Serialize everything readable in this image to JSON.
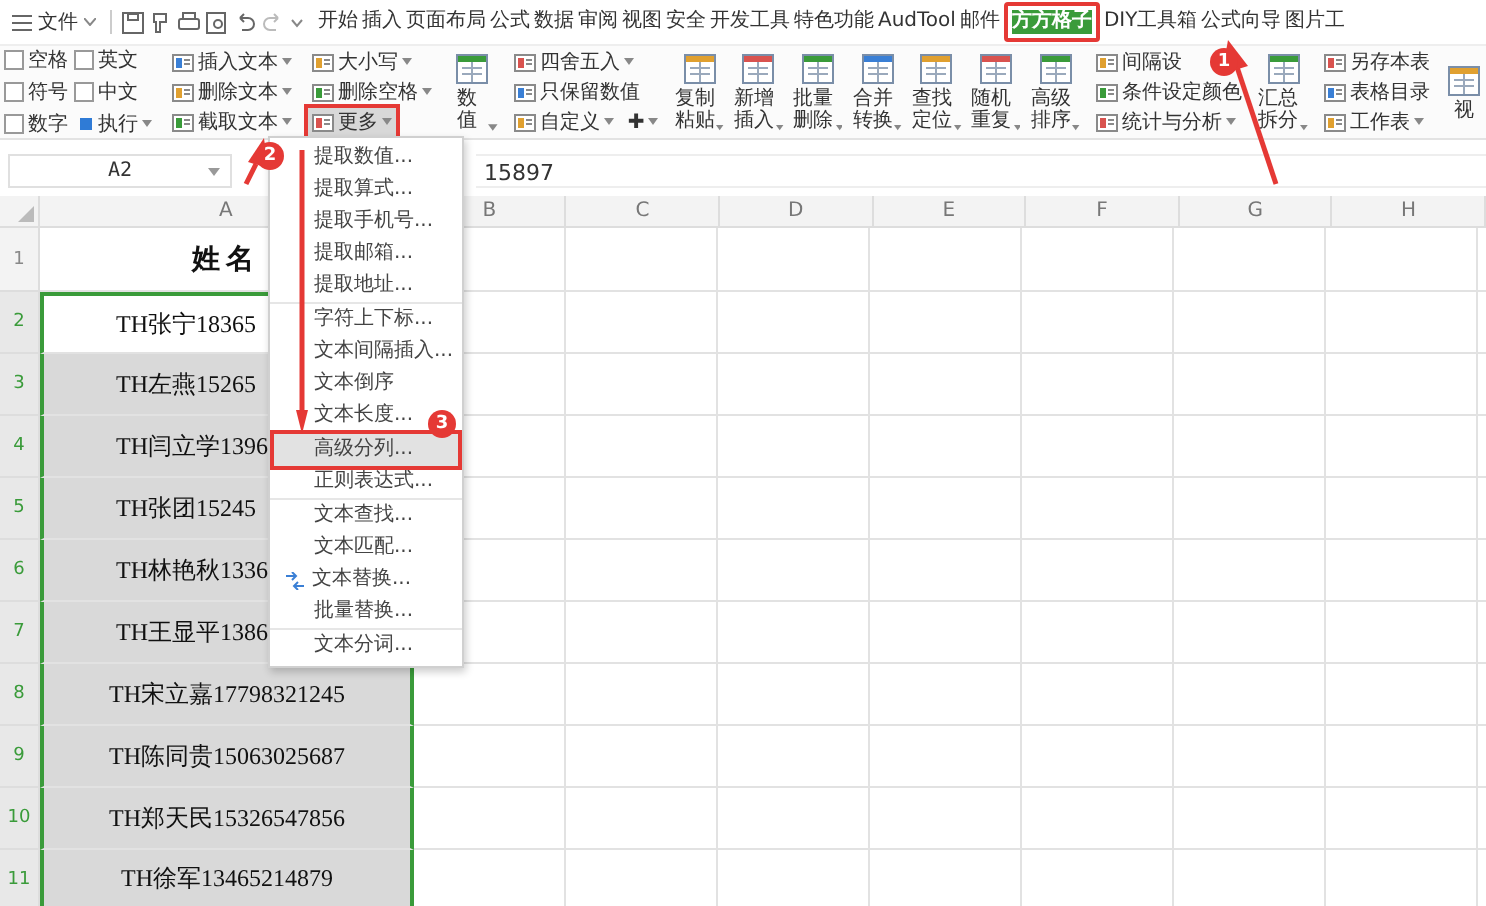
{
  "menubar": {
    "file_menu": "文件",
    "tabs": [
      {
        "label": "开始",
        "selected": false,
        "marked": false
      },
      {
        "label": "插入",
        "selected": false,
        "marked": false
      },
      {
        "label": "页面布局",
        "selected": false,
        "marked": false
      },
      {
        "label": "公式",
        "selected": false,
        "marked": false
      },
      {
        "label": "数据",
        "selected": false,
        "marked": false
      },
      {
        "label": "审阅",
        "selected": false,
        "marked": false
      },
      {
        "label": "视图",
        "selected": false,
        "marked": false
      },
      {
        "label": "安全",
        "selected": false,
        "marked": false
      },
      {
        "label": "开发工具",
        "selected": false,
        "marked": false
      },
      {
        "label": "特色功能",
        "selected": false,
        "marked": false
      },
      {
        "label": "AudTool",
        "selected": false,
        "marked": false
      },
      {
        "label": "邮件",
        "selected": false,
        "marked": false
      },
      {
        "label": "方方格子",
        "selected": true,
        "marked": true
      },
      {
        "label": "DIY工具箱",
        "selected": false,
        "marked": false
      },
      {
        "label": "公式向导",
        "selected": false,
        "marked": false
      },
      {
        "label": "图片工",
        "selected": false,
        "marked": false
      }
    ]
  },
  "ribbon": {
    "groups": [
      {
        "kind": "checks",
        "items": [
          {
            "label": "空格",
            "checked": false
          },
          {
            "label": "英文",
            "checked": false
          },
          {
            "label": "符号",
            "checked": false
          },
          {
            "label": "中文",
            "checked": false
          },
          {
            "label": "数字",
            "checked": false
          }
        ],
        "action": "执行"
      },
      {
        "kind": "small",
        "items": [
          {
            "label": "插入文本",
            "dropdown": true,
            "marked": false
          },
          {
            "label": "删除文本",
            "dropdown": true,
            "marked": false
          },
          {
            "label": "截取文本",
            "dropdown": true,
            "marked": false
          }
        ]
      },
      {
        "kind": "small",
        "items": [
          {
            "label": "大小写",
            "dropdown": true,
            "marked": false
          },
          {
            "label": "删除空格",
            "dropdown": true,
            "marked": false
          },
          {
            "label": "更多",
            "dropdown": true,
            "marked": true
          }
        ]
      },
      {
        "kind": "big",
        "items": [
          {
            "label": "数值",
            "dropdown": true,
            "marked": false
          }
        ]
      },
      {
        "kind": "small",
        "items": [
          {
            "label": "四舍五入",
            "dropdown": true,
            "marked": false
          },
          {
            "label": "只保留数值",
            "dropdown": false,
            "marked": false
          },
          {
            "label": "自定义",
            "dropdown": true,
            "marked": false
          },
          {
            "label": "✚",
            "dropdown": true,
            "marked": false,
            "inline": true
          }
        ]
      },
      {
        "kind": "big",
        "items": [
          {
            "label": "复制粘贴",
            "dropdown": true,
            "marked": false
          },
          {
            "label": "新增插入",
            "dropdown": true,
            "marked": false
          },
          {
            "label": "批量删除",
            "dropdown": true,
            "marked": false
          },
          {
            "label": "合并转换",
            "dropdown": true,
            "marked": false
          },
          {
            "label": "查找定位",
            "dropdown": true,
            "marked": false
          },
          {
            "label": "随机重复",
            "dropdown": true,
            "marked": false
          },
          {
            "label": "高级排序",
            "dropdown": true,
            "marked": false
          }
        ]
      },
      {
        "kind": "small",
        "items": [
          {
            "label": "间隔设",
            "dropdown": false,
            "marked": false
          },
          {
            "label": "条件设定颜色",
            "dropdown": false,
            "marked": false
          },
          {
            "label": "统计与分析",
            "dropdown": true,
            "marked": false
          }
        ]
      },
      {
        "kind": "big",
        "items": [
          {
            "label": "汇总拆分",
            "dropdown": true,
            "marked": false
          }
        ]
      },
      {
        "kind": "small",
        "items": [
          {
            "label": "另存本表",
            "dropdown": false,
            "marked": false
          },
          {
            "label": "表格目录",
            "dropdown": false,
            "marked": false
          },
          {
            "label": "工作表",
            "dropdown": true,
            "marked": false
          }
        ]
      },
      {
        "kind": "big",
        "items": [
          {
            "label": "视",
            "dropdown": false,
            "marked": false
          }
        ]
      }
    ]
  },
  "formula_bar": {
    "name_box": "A2",
    "formula": "15897"
  },
  "sheet": {
    "columns": [
      "A",
      "B",
      "C",
      "D",
      "E",
      "F",
      "G",
      "H"
    ],
    "rows": [
      {
        "number": "1",
        "text": "姓名",
        "kind": "header",
        "selected": false,
        "active": false
      },
      {
        "number": "2",
        "text": "TH张宁18365",
        "kind": "cut",
        "selected": true,
        "active": true
      },
      {
        "number": "3",
        "text": "TH左燕15265",
        "kind": "cut",
        "selected": true,
        "active": false
      },
      {
        "number": "4",
        "text": "TH闫立学1396",
        "kind": "cut",
        "selected": true,
        "active": false
      },
      {
        "number": "5",
        "text": "TH张团15245",
        "kind": "cut",
        "selected": true,
        "active": false
      },
      {
        "number": "6",
        "text": "TH林艳秋1336",
        "kind": "cut",
        "selected": true,
        "active": false
      },
      {
        "number": "7",
        "text": "TH王显平1386",
        "kind": "cut",
        "selected": true,
        "active": false
      },
      {
        "number": "8",
        "text": "TH宋立嘉17798321245",
        "kind": "full",
        "selected": true,
        "active": false
      },
      {
        "number": "9",
        "text": "TH陈同贵15063025687",
        "kind": "full",
        "selected": true,
        "active": false
      },
      {
        "number": "10",
        "text": "TH郑天民15326547856",
        "kind": "full",
        "selected": true,
        "active": false
      },
      {
        "number": "11",
        "text": "TH徐军13465214879",
        "kind": "full",
        "selected": true,
        "active": false
      }
    ]
  },
  "dropdown_menu": {
    "sections": [
      [
        {
          "label": "提取数值...",
          "marked": false
        },
        {
          "label": "提取算式...",
          "marked": false
        },
        {
          "label": "提取手机号...",
          "marked": false
        },
        {
          "label": "提取邮箱...",
          "marked": false
        },
        {
          "label": "提取地址...",
          "marked": false
        }
      ],
      [
        {
          "label": "字符上下标...",
          "marked": false
        },
        {
          "label": "文本间隔插入...",
          "marked": false
        },
        {
          "label": "文本倒序",
          "marked": false
        },
        {
          "label": "文本长度...",
          "marked": false
        }
      ],
      [
        {
          "label": "高级分列...",
          "marked": true
        },
        {
          "label": "正则表达式...",
          "marked": false
        }
      ],
      [
        {
          "label": "文本查找...",
          "marked": false
        },
        {
          "label": "文本匹配...",
          "marked": false
        },
        {
          "label": "文本替换...",
          "marked": false,
          "icon": true
        },
        {
          "label": "批量替换...",
          "marked": false
        }
      ],
      [
        {
          "label": "文本分词...",
          "marked": false
        }
      ]
    ]
  },
  "annotations": {
    "badges": [
      "1",
      "2",
      "3"
    ]
  }
}
